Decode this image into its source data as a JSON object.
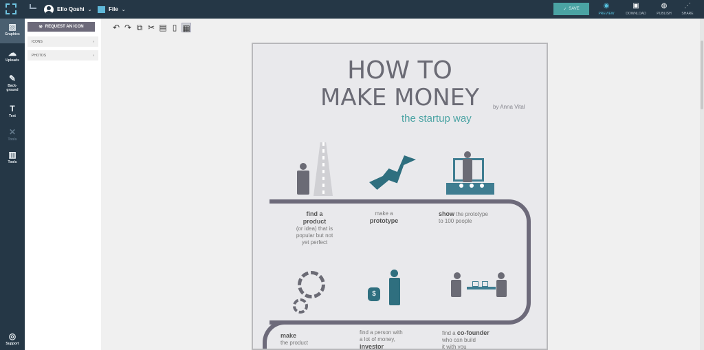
{
  "header": {
    "user_name": "Ello Qoshi",
    "file_label": "File",
    "save_label": "SAVE",
    "actions": [
      {
        "label": "PREVIEW",
        "icon": "eye-icon"
      },
      {
        "label": "DOWNLOAD",
        "icon": "download-icon"
      },
      {
        "label": "PUBLISH",
        "icon": "globe-icon"
      },
      {
        "label": "SHARE",
        "icon": "share-icon"
      }
    ]
  },
  "sidebar": {
    "items": [
      {
        "label": "Graphics",
        "icon": "image-icon",
        "active": true
      },
      {
        "label": "Uploads",
        "icon": "cloud-upload-icon"
      },
      {
        "label": "Back-\nground",
        "icon": "brush-icon"
      },
      {
        "label": "Text",
        "icon": "text-icon"
      },
      {
        "label": "Tools",
        "icon": "close-icon"
      },
      {
        "label": "Tools",
        "icon": "toolbox-icon"
      }
    ],
    "support_label": "Support"
  },
  "panel": {
    "request_label": "REQUEST AN ICON",
    "icons_label": "ICONS",
    "photos_label": "PHOTOS"
  },
  "toolbar": {
    "icons": [
      "undo-icon",
      "redo-icon",
      "copy-icon",
      "cut-icon",
      "paste-icon",
      "delete-icon",
      "grid-icon"
    ]
  },
  "canvas": {
    "title_line1": "HOW TO",
    "title_line2": "MAKE MONEY",
    "byline": "by Anna Vital",
    "subtitle": "the startup way",
    "steps": [
      {
        "bold": "find a\nproduct",
        "text": "(or idea) that is\npopular but not\nyet perfect"
      },
      {
        "before": "make a",
        "bold": "prototype"
      },
      {
        "bold": "show",
        "text": "the prototype\nto 100 people"
      },
      {
        "bold": "make",
        "text": "the product"
      },
      {
        "text": "find a person with\na lot of money,",
        "bold": "investor"
      },
      {
        "before": "find a",
        "bold": "co-founder",
        "text": "who can build\nit with you"
      }
    ],
    "money_sign": "$"
  },
  "colors": {
    "dark": "#253746",
    "accent": "#4aa3a3",
    "canvas": "#e9e9ec"
  }
}
